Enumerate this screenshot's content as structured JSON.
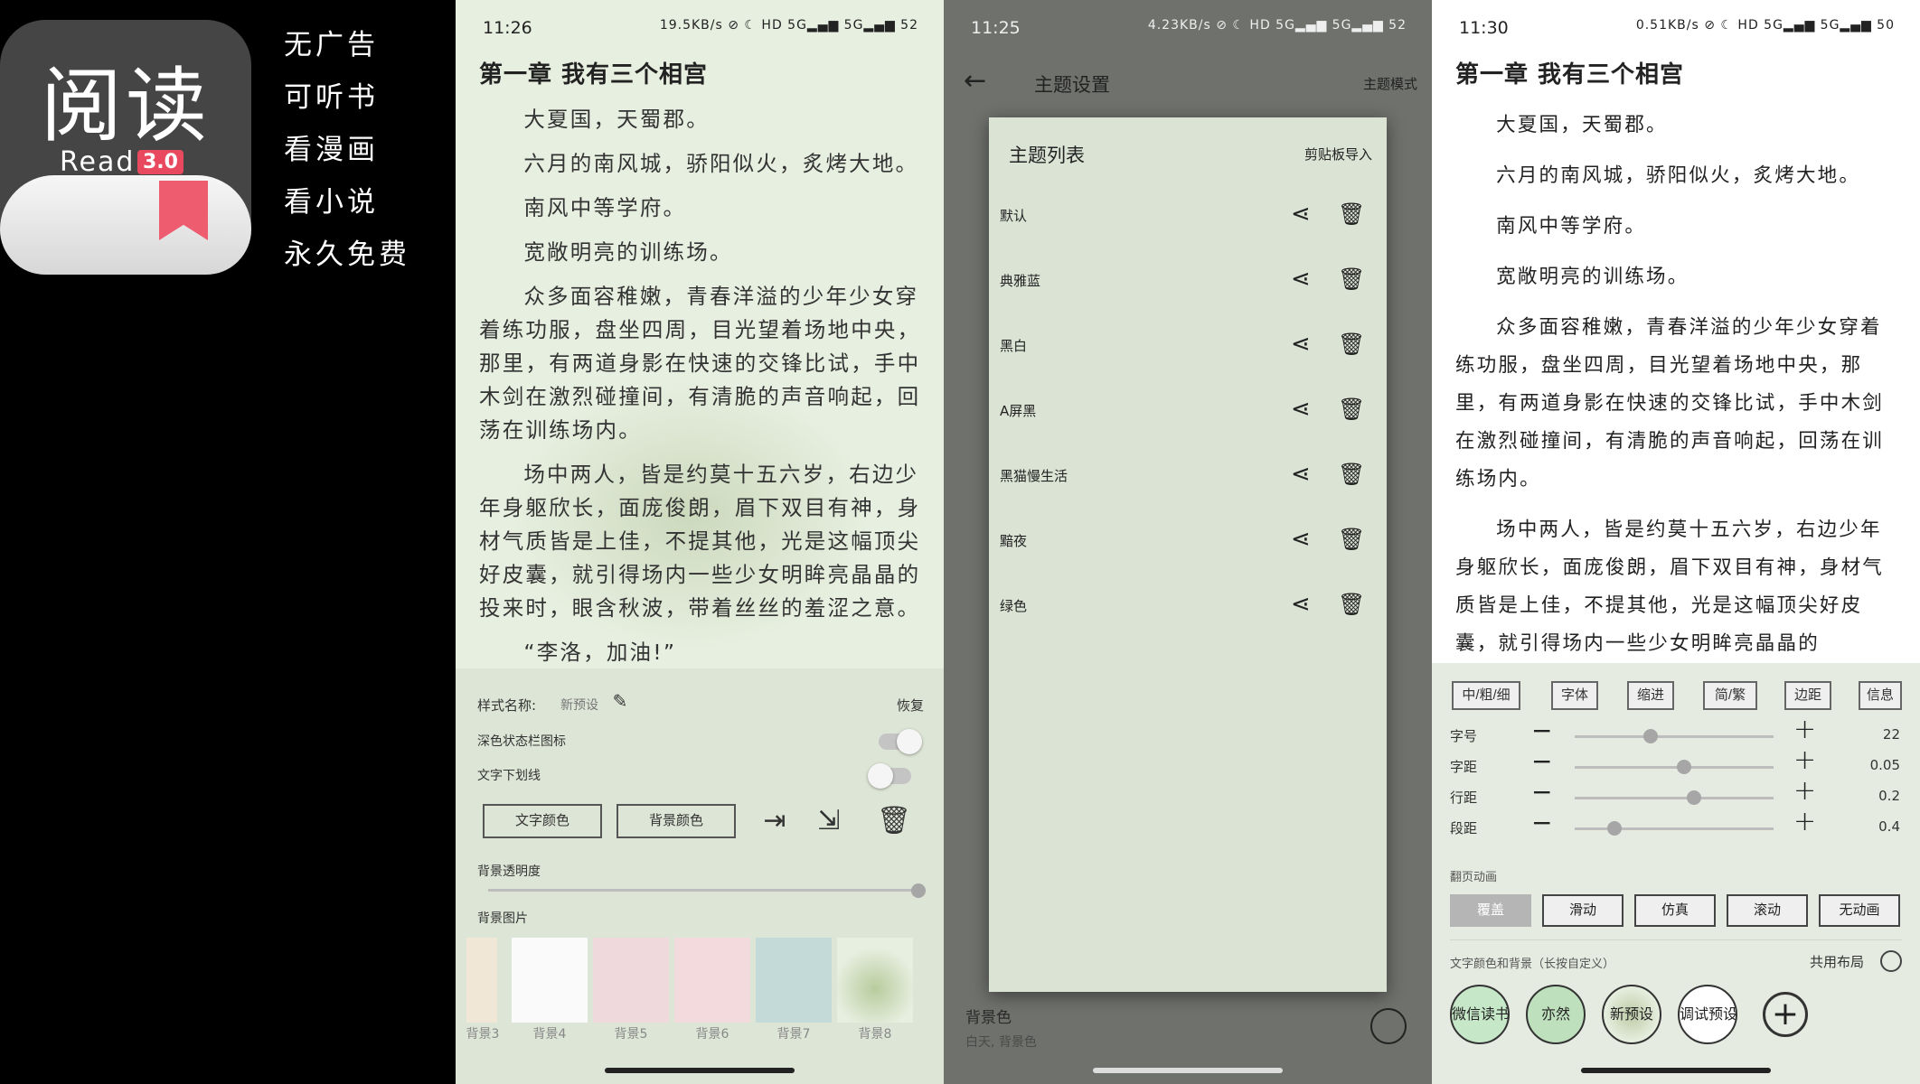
{
  "promo": {
    "logo_text": "阅读",
    "logo_read": "Read",
    "logo_version": "3.0",
    "slogans": [
      "无广告",
      "可听书",
      "看漫画",
      "看小说",
      "永久免费"
    ]
  },
  "reader1": {
    "status_time": "11:26",
    "status_icons": "19.5KB/s ⊘ ☾ HD 5G▂▄▆ 5G▂▄▆ 52",
    "chapter_title": "第一章 我有三个相宫",
    "paragraphs": [
      "大夏国，天蜀郡。",
      "六月的南风城，骄阳似火，炙烤大地。",
      "南风中等学府。",
      "宽敞明亮的训练场。",
      "众多面容稚嫩，青春洋溢的少年少女穿着练功服，盘坐四周，目光望着场地中央，那里，有两道身影在快速的交锋比试，手中木剑在激烈碰撞间，有清脆的声音响起，回荡在训练场内。",
      "场中两人，皆是约莫十五六岁，右边少年身躯欣长，面庞俊朗，眉下双目有神，身材气质皆是上佳，不提其他，光是这幅顶尖好皮囊，就引得场内一些少女明眸亮晶晶的投来时，眼含秋波，带着丝丝的羞涩之意。",
      "“李洛，加油!”"
    ],
    "style_name_label": "样式名称:",
    "style_name_value": "新预设",
    "restore_label": "恢复",
    "dark_status_label": "深色状态栏图标",
    "underline_label": "文字下划线",
    "text_color_btn": "文字颜色",
    "bg_color_btn": "背景颜色",
    "bg_alpha_label": "背景透明度",
    "bg_alpha_value": 1.0,
    "bg_image_label": "背景图片",
    "bg_thumbs": [
      "背景3",
      "背景4",
      "背景5",
      "背景6",
      "背景7",
      "背景8"
    ]
  },
  "theme": {
    "status_time": "11:25",
    "status_icons": "4.23KB/s ⊘ ☾ HD 5G▂▄▆ 5G▂▄▆ 52",
    "title": "主题设置",
    "mode_label": "主题模式",
    "dialog_title": "主题列表",
    "clipboard_import": "剪贴板导入",
    "themes": [
      "默认",
      "典雅蓝",
      "黑白",
      "A屏黑",
      "黑猫慢生活",
      "黯夜",
      "绿色"
    ],
    "bg_row_label": "背景色",
    "bg_row_sub": "白天, 背景色"
  },
  "reader2": {
    "status_time": "11:30",
    "status_icons": "0.51KB/s ⊘ ☾ HD 5G▂▄▆ 5G▂▄▆ 50",
    "chapter_title": "第一章 我有三个相宫",
    "paragraphs": [
      "大夏国，天蜀郡。",
      "六月的南风城，骄阳似火，炙烤大地。",
      "南风中等学府。",
      "宽敞明亮的训练场。",
      "众多面容稚嫩，青春洋溢的少年少女穿着练功服，盘坐四周，目光望着场地中央，那里，有两道身影在快速的交锋比试，手中木剑在激烈碰撞间，有清脆的声音响起，回荡在训练场内。",
      "场中两人，皆是约莫十五六岁，右边少年身躯欣长，面庞俊朗，眉下双目有神，身材气质皆是上佳，不提其他，光是这幅顶尖好皮囊，就引得场内一些少女明眸亮晶晶的"
    ],
    "chips": [
      "中/粗/细",
      "字体",
      "缩进",
      "简/繁",
      "边距",
      "信息"
    ],
    "rows": [
      {
        "label": "字号",
        "value": "22",
        "fraction": 0.38
      },
      {
        "label": "字距",
        "value": "0.05",
        "fraction": 0.55
      },
      {
        "label": "行距",
        "value": "0.2",
        "fraction": 0.6
      },
      {
        "label": "段距",
        "value": "0.4",
        "fraction": 0.2
      }
    ],
    "page_anim_label": "翻页动画",
    "page_anims": [
      "覆盖",
      "滑动",
      "仿真",
      "滚动",
      "无动画"
    ],
    "color_label": "文字颜色和背景（长按自定义）",
    "shared_layout_label": "共用布局",
    "presets": [
      "微信读书",
      "亦然",
      "新预设",
      "调试预设"
    ],
    "colors": {
      "accent_green": "#c6e8c8",
      "preset_green": "#bfe0bd"
    }
  }
}
